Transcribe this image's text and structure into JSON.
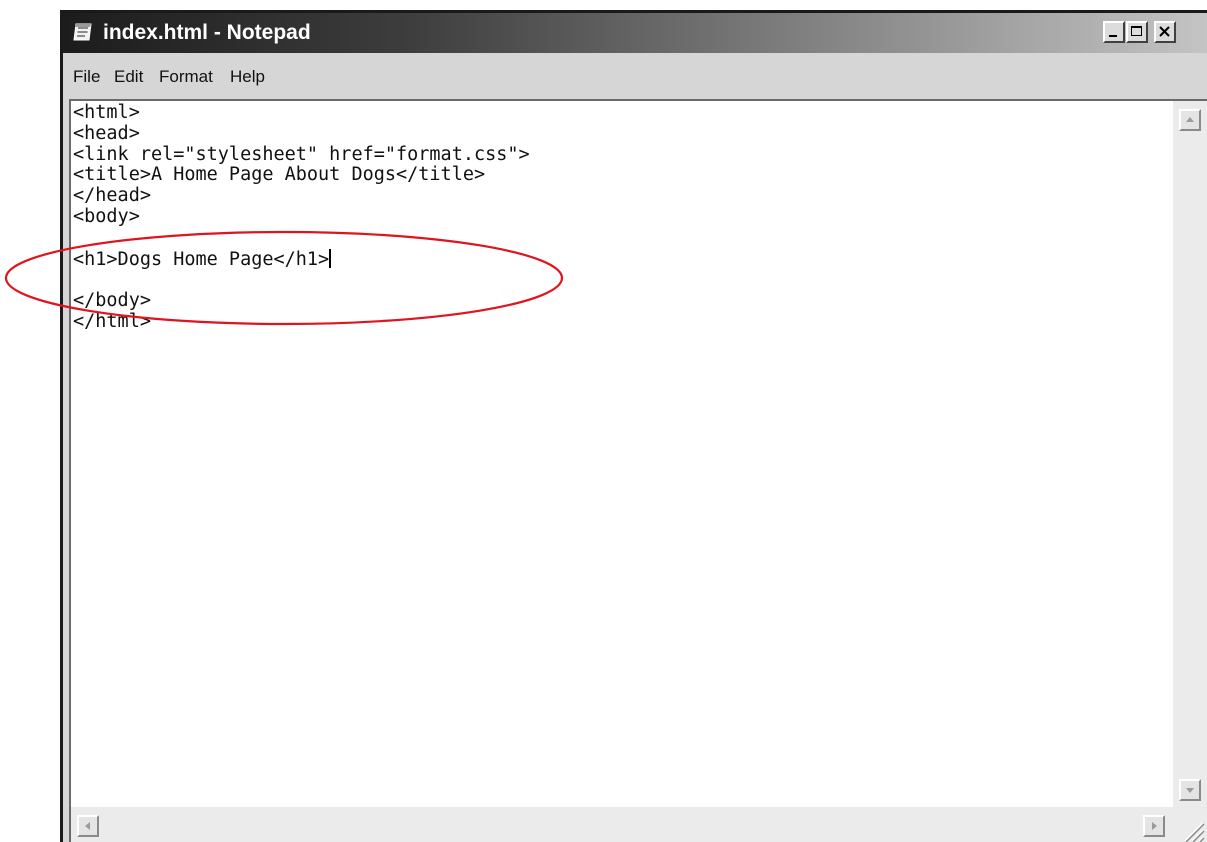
{
  "window": {
    "title": "index.html - Notepad",
    "app_icon": "notepad-icon",
    "controls": {
      "minimize_icon": "minimize-icon",
      "maximize_icon": "maximize-icon",
      "close_icon": "close-icon"
    }
  },
  "menu": {
    "file": "File",
    "edit": "Edit",
    "format": "Format",
    "help": "Help"
  },
  "editor": {
    "lines": [
      "<html>",
      "<head>",
      "<link rel=\"stylesheet\" href=\"format.css\">",
      "<title>A Home Page About Dogs</title>",
      "</head>",
      "<body>",
      "",
      "<h1>Dogs Home Page</h1>",
      "",
      "</body>",
      "</html>"
    ],
    "caret_line": 8
  },
  "annotation": {
    "shape": "ellipse",
    "color": "#e0141e",
    "target": "<h1>Dogs Home Page</h1>"
  },
  "colors": {
    "title_bar_start": "#1c1c1c",
    "title_bar_end": "#c4c4c4",
    "chrome": "#d6d6d6",
    "editor_background": "#ffffff"
  }
}
